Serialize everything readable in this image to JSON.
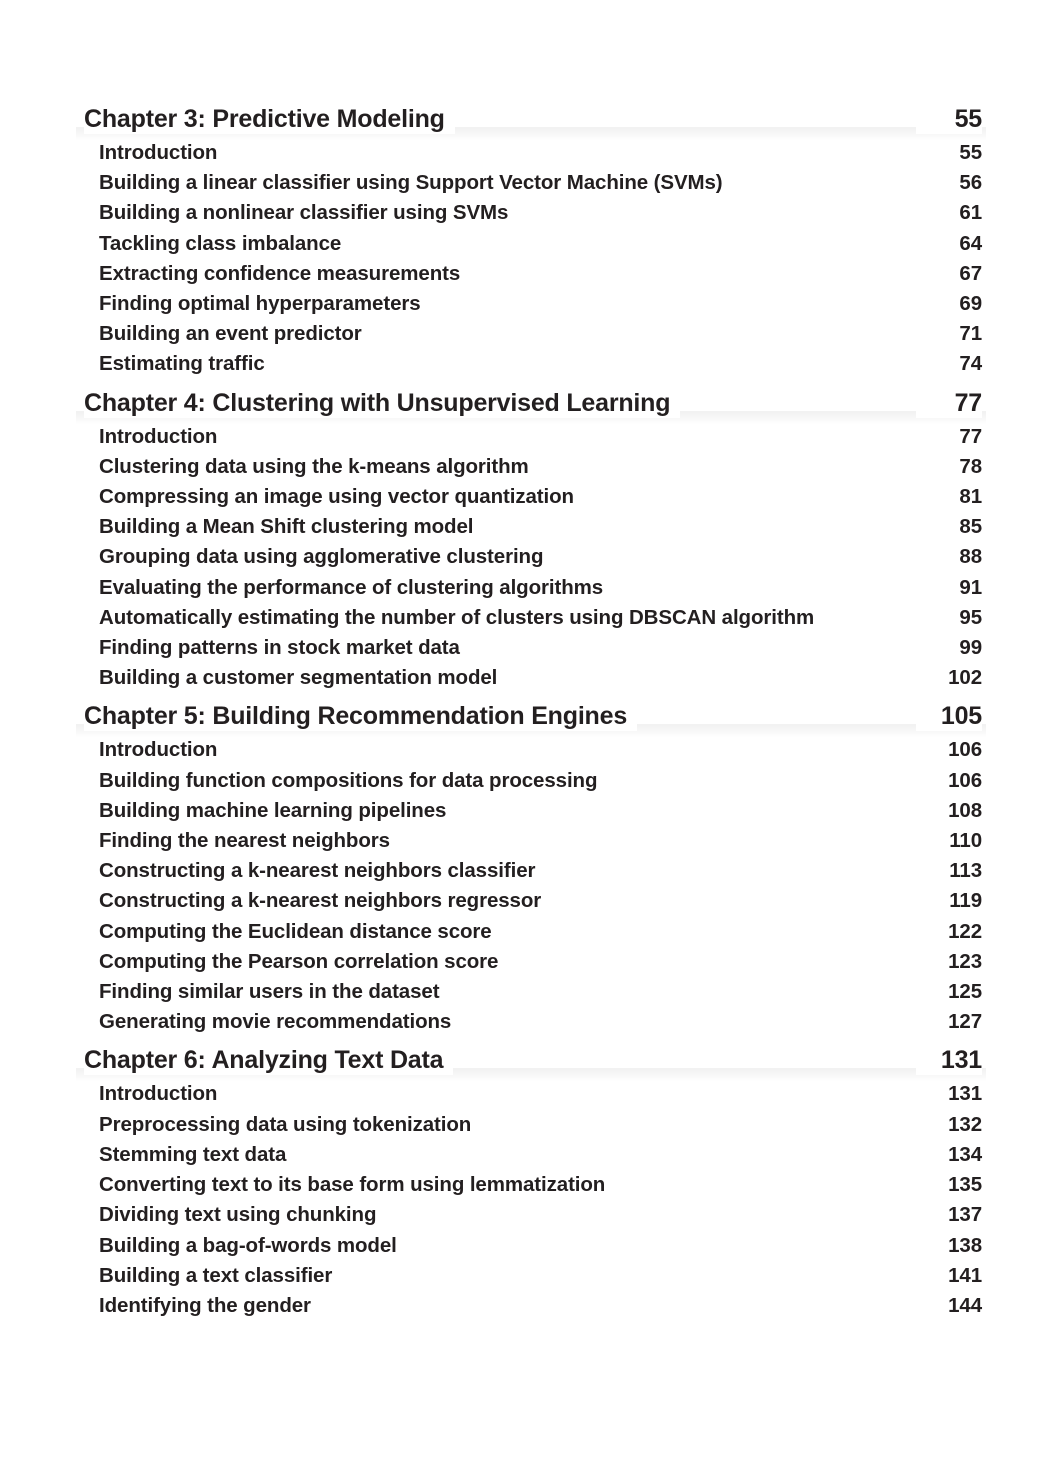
{
  "document": {
    "type": "table-of-contents",
    "text_color": "#231f20",
    "background_color": "#ffffff"
  },
  "chapters": [
    {
      "title": "Chapter 3: Predictive Modeling",
      "page": "55",
      "entries": [
        {
          "title": "Introduction",
          "page": "55"
        },
        {
          "title": "Building a linear classifier using Support Vector Machine (SVMs)",
          "page": "56"
        },
        {
          "title": "Building a nonlinear classifier using SVMs",
          "page": "61"
        },
        {
          "title": "Tackling class imbalance",
          "page": "64"
        },
        {
          "title": "Extracting confidence measurements",
          "page": "67"
        },
        {
          "title": "Finding optimal hyperparameters",
          "page": "69"
        },
        {
          "title": "Building an event predictor",
          "page": "71"
        },
        {
          "title": "Estimating traffic",
          "page": "74"
        }
      ]
    },
    {
      "title": "Chapter 4: Clustering with Unsupervised Learning",
      "page": "77",
      "entries": [
        {
          "title": "Introduction",
          "page": "77"
        },
        {
          "title": "Clustering data using the k-means algorithm",
          "page": "78"
        },
        {
          "title": "Compressing an image using vector quantization",
          "page": "81"
        },
        {
          "title": "Building a Mean Shift clustering model",
          "page": "85"
        },
        {
          "title": "Grouping data using agglomerative clustering",
          "page": "88"
        },
        {
          "title": "Evaluating the performance of clustering algorithms",
          "page": "91"
        },
        {
          "title": "Automatically estimating the number of clusters using DBSCAN algorithm",
          "page": "95"
        },
        {
          "title": "Finding patterns in stock market data",
          "page": "99"
        },
        {
          "title": "Building a customer segmentation model",
          "page": "102"
        }
      ]
    },
    {
      "title": "Chapter 5: Building Recommendation Engines",
      "page": "105",
      "entries": [
        {
          "title": "Introduction",
          "page": "106"
        },
        {
          "title": "Building function compositions for data processing",
          "page": "106"
        },
        {
          "title": "Building machine learning pipelines",
          "page": "108"
        },
        {
          "title": "Finding the nearest neighbors",
          "page": "110"
        },
        {
          "title": "Constructing a k-nearest neighbors classifier",
          "page": "113"
        },
        {
          "title": "Constructing a k-nearest neighbors regressor",
          "page": "119"
        },
        {
          "title": "Computing the Euclidean distance score",
          "page": "122"
        },
        {
          "title": "Computing the Pearson correlation score",
          "page": "123"
        },
        {
          "title": "Finding similar users in the dataset",
          "page": "125"
        },
        {
          "title": "Generating movie recommendations",
          "page": "127"
        }
      ]
    },
    {
      "title": "Chapter 6: Analyzing Text Data",
      "page": "131",
      "entries": [
        {
          "title": "Introduction",
          "page": "131"
        },
        {
          "title": "Preprocessing data using tokenization",
          "page": "132"
        },
        {
          "title": "Stemming text data",
          "page": "134"
        },
        {
          "title": "Converting text to its base form using lemmatization",
          "page": "135"
        },
        {
          "title": "Dividing text using chunking",
          "page": "137"
        },
        {
          "title": "Building a bag-of-words model",
          "page": "138"
        },
        {
          "title": "Building a text classifier",
          "page": "141"
        },
        {
          "title": "Identifying the gender",
          "page": "144"
        }
      ]
    }
  ]
}
